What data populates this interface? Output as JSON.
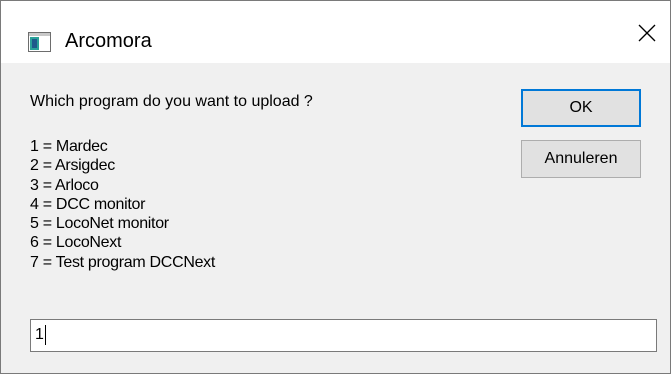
{
  "window": {
    "title": "Arcomora"
  },
  "dialog": {
    "prompt": "Which program do you want to upload ?",
    "options": [
      "1 = Mardec",
      "2 = Arsigdec",
      "3 = Arloco",
      "4 = DCC monitor",
      "5 = LocoNet monitor",
      "6 = LocoNext",
      "7 = Test program DCCNext"
    ],
    "ok_label": "OK",
    "cancel_label": "Annuleren",
    "input_value": "1"
  },
  "icons": {
    "app": "app-window-icon",
    "close": "close-icon"
  },
  "colors": {
    "dialog_bg": "#f0f0f0",
    "titlebar_bg": "#ffffff",
    "focus_accent": "#0078d7",
    "button_bg": "#e1e1e1"
  }
}
